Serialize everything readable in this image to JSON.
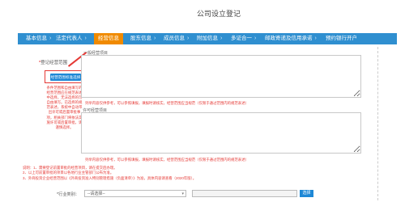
{
  "page": {
    "title": "公司设立登记"
  },
  "steps": [
    {
      "label": "基本信息"
    },
    {
      "label": "法定代表人"
    },
    {
      "label": "经营信息"
    },
    {
      "label": "股东信息"
    },
    {
      "label": "成员信息"
    },
    {
      "label": "附加信息"
    },
    {
      "label": "多证合一"
    },
    {
      "label": "邮政寄递及信用承诺"
    },
    {
      "label": "预约银行开户"
    }
  ],
  "active_step": "经营信息",
  "left_panel": {
    "required_star": "*",
    "required_label": "登记经营范围",
    "select_button": "经营范围标准选择",
    "tip": "条件范围和自由填写的经营范围应在规范表述中选择，无法选择的可自由填写。已选择的规范表述，系统中自动带出许可或后置审批事项，相关部门将依法实施许可或后置审批，请谨慎选择。"
  },
  "general_scope": {
    "label": "一般经营项目",
    "hint": "列举内容仅供参考，可以参照填报，填报时请核实，经营范围应当规范（仅限于通过范围内的规范表述）"
  },
  "licensed_scope": {
    "label": "许可经营项目",
    "hint": "列举内容仅供参考，可以参照填报，填报时请核实，经营范围应当规范（仅限于通过范围内的规范表述）"
  },
  "notes": [
    "说明：1、需要登记前置审批的经营项目，请在提交后办理。",
    "2、以上可前置审批的项目以各地行业主管部门公布为准。",
    "3、外商投资企业经营范围以《外商投资准入特别管理措施（负面清单）》为准，具体内容请查看（2020年版）。"
  ],
  "industry": {
    "label": "*行业类别：",
    "select_value": "--请选择--",
    "search_button": "选择"
  },
  "colors": {
    "step_bar": "#2f8fd0",
    "step_active": "#f08a00",
    "highlight_red": "#e53935",
    "button_blue": "#1e88d6"
  }
}
